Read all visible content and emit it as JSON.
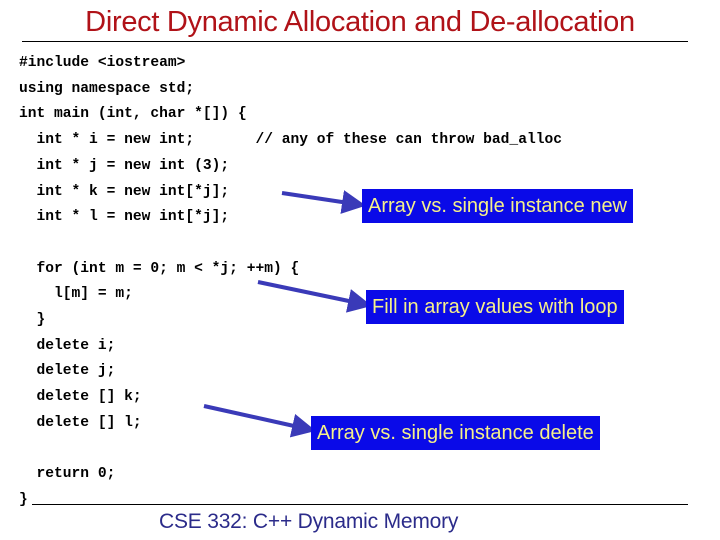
{
  "slide": {
    "title": "Direct Dynamic Allocation and De-allocation",
    "footer": "CSE 332: C++ Dynamic Memory",
    "colors": {
      "title": "#b01218",
      "footer": "#2b2b8a",
      "callout_bg": "#0a0ae8",
      "callout_text": "#f5f08a",
      "arrow": "#3a3ab8"
    }
  },
  "code": {
    "lines": [
      "#include <iostream>",
      "using namespace std;",
      "int main (int, char *[]) {",
      "  int * i = new int;       // any of these can throw bad_alloc",
      "  int * j = new int (3);",
      "  int * k = new int[*j];",
      "  int * l = new int[*j];",
      "",
      "  for (int m = 0; m < *j; ++m) {",
      "    l[m] = m;",
      "  }",
      "  delete i;",
      "  delete j;",
      "  delete [] k;",
      "  delete [] l;",
      "",
      "  return 0;",
      "}"
    ]
  },
  "callouts": [
    {
      "label": "Array vs. single instance new",
      "points_to": "int * k = new int[*j];"
    },
    {
      "label": "Fill in array values with loop",
      "points_to": "for (int m = 0; m < *j; ++m) {"
    },
    {
      "label": "Array vs. single instance delete",
      "points_to": "delete [] k;"
    }
  ]
}
